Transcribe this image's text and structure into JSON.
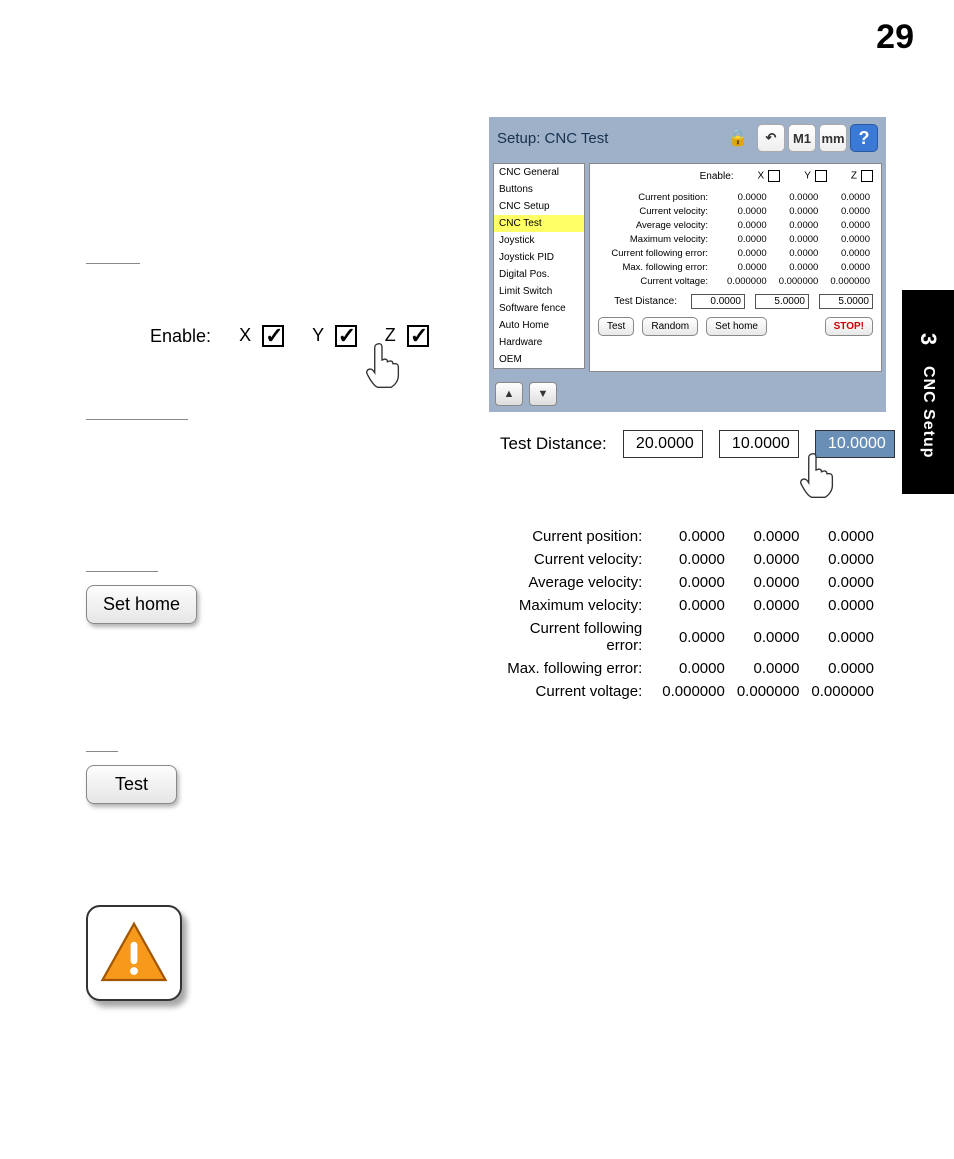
{
  "page_number": "29",
  "side_tab": {
    "num": "3",
    "text": "CNC Setup"
  },
  "enable_row": {
    "label": "Enable:",
    "x": "X",
    "y": "Y",
    "z": "Z",
    "x_checked": true,
    "y_checked": true,
    "z_checked": true
  },
  "set_home_label": "Set home",
  "test_label": "Test",
  "screenshot": {
    "title": "Setup: CNC Test",
    "toolbar": {
      "m1": "M1",
      "mm": "mm",
      "help": "?"
    },
    "sidebar": [
      "CNC General",
      "Buttons",
      "CNC Setup",
      "CNC Test",
      "Joystick",
      "Joystick PID",
      "Digital Pos.",
      "Limit Switch",
      "Software fence",
      "Auto Home",
      "Hardware",
      "OEM"
    ],
    "sidebar_selected_index": 3,
    "enable_label": "Enable:",
    "axes": [
      "X",
      "Y",
      "Z"
    ],
    "rows": [
      {
        "label": "Current position:",
        "v": [
          "0.0000",
          "0.0000",
          "0.0000"
        ]
      },
      {
        "label": "Current velocity:",
        "v": [
          "0.0000",
          "0.0000",
          "0.0000"
        ]
      },
      {
        "label": "Average velocity:",
        "v": [
          "0.0000",
          "0.0000",
          "0.0000"
        ]
      },
      {
        "label": "Maximum velocity:",
        "v": [
          "0.0000",
          "0.0000",
          "0.0000"
        ]
      },
      {
        "label": "Current following error:",
        "v": [
          "0.0000",
          "0.0000",
          "0.0000"
        ]
      },
      {
        "label": "Max. following error:",
        "v": [
          "0.0000",
          "0.0000",
          "0.0000"
        ]
      },
      {
        "label": "Current voltage:",
        "v": [
          "0.000000",
          "0.000000",
          "0.000000"
        ]
      }
    ],
    "test_distance_label": "Test Distance:",
    "test_distance": [
      "0.0000",
      "5.0000",
      "5.0000"
    ],
    "buttons": {
      "test": "Test",
      "random": "Random",
      "sethome": "Set home",
      "stop": "STOP!"
    }
  },
  "td_big": {
    "label": "Test Distance:",
    "values": [
      "20.0000",
      "10.0000",
      "10.0000"
    ],
    "selected_index": 2
  },
  "stats_big": [
    {
      "label": "Current position:",
      "v": [
        "0.0000",
        "0.0000",
        "0.0000"
      ]
    },
    {
      "label": "Current velocity:",
      "v": [
        "0.0000",
        "0.0000",
        "0.0000"
      ]
    },
    {
      "label": "Average velocity:",
      "v": [
        "0.0000",
        "0.0000",
        "0.0000"
      ]
    },
    {
      "label": "Maximum velocity:",
      "v": [
        "0.0000",
        "0.0000",
        "0.0000"
      ]
    },
    {
      "label": "Current following error:",
      "v": [
        "0.0000",
        "0.0000",
        "0.0000"
      ]
    },
    {
      "label": "Max. following error:",
      "v": [
        "0.0000",
        "0.0000",
        "0.0000"
      ]
    },
    {
      "label": "Current voltage:",
      "v": [
        "0.000000",
        "0.000000",
        "0.000000"
      ]
    }
  ]
}
